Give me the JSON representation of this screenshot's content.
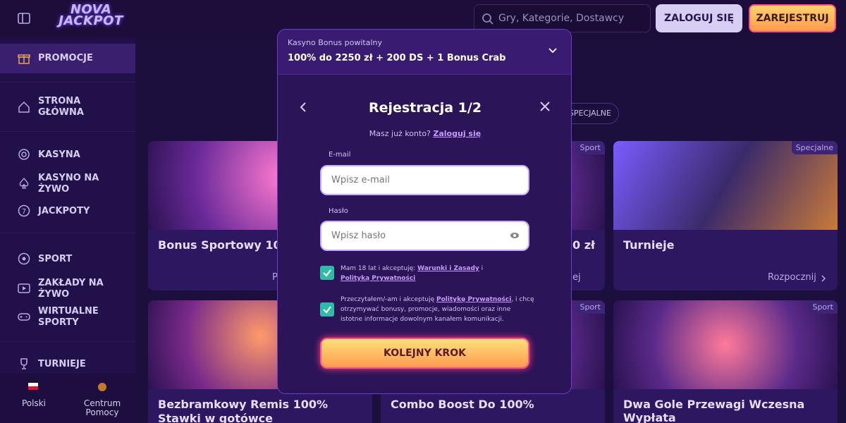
{
  "header": {
    "logo_line1": "NOVA",
    "logo_line2": "JACKPOT",
    "search_placeholder": "Gry, Kategorie, Dostawcy",
    "login_label": "ZALOGUJ SIĘ",
    "register_label": "ZAREJESTRUJ"
  },
  "sidebar": {
    "items": [
      {
        "label": "PROMOCJE",
        "icon": "gift-icon"
      },
      {
        "label": "STRONA GŁÓWNA",
        "icon": "home-icon"
      },
      {
        "label": "KASYNA",
        "icon": "roulette-icon"
      },
      {
        "label": "KASYNO NA ŻYWO",
        "icon": "spade-icon"
      },
      {
        "label": "JACKPOTY",
        "icon": "seven-icon"
      },
      {
        "label": "SPORT",
        "icon": "ball-icon"
      },
      {
        "label": "ZAKŁADY NA ŻYWO",
        "icon": "play-icon"
      },
      {
        "label": "WIRTUALNE SPORTY",
        "icon": "gamepad-icon"
      },
      {
        "label": "TURNIEJE",
        "icon": "trophy-icon"
      }
    ],
    "language": "Polski",
    "help": "Centrum Pomocy"
  },
  "main": {
    "filter_pill": "SPECJALNE",
    "cards": [
      {
        "title": "Bonus Sportowy 100%",
        "tag": "",
        "cta": "P"
      },
      {
        "title": "0 zł",
        "tag": "Sport",
        "cta": "ej"
      },
      {
        "title": "Turnieje",
        "tag": "Specjalne",
        "cta": "Rozpocznij"
      },
      {
        "title": "Bezbramkowy Remis 100% Stawki w gotówce",
        "tag": "",
        "cta": ""
      },
      {
        "title": "Combo Boost Do 100%",
        "tag": "Sport",
        "cta": ""
      },
      {
        "title": "Dwa Gole Przewagi Wczesna Wypłata",
        "tag": "Sport",
        "cta": ""
      }
    ]
  },
  "modal": {
    "bonus_subtitle": "Kasyno Bonus powitalny",
    "bonus_title": "100% do 2250 zł + 200 DS + 1 Bonus Crab",
    "title": "Rejestracja 1/2",
    "have_account": "Masz już konto?",
    "login_link": "Zaloguj się",
    "email_label": "E-mail",
    "email_placeholder": "Wpisz e-mail",
    "password_label": "Hasło",
    "password_placeholder": "Wpisz hasło",
    "consent1_text": "Mam 18 lat i akceptuję:",
    "consent1_link1": "Warunki i Zasady",
    "consent1_and": "i",
    "consent1_link2": "Polityką Prywatności",
    "consent2_text_a": "Przeczytałem/-am i akceptuję",
    "consent2_link": "Politykę Prywatności",
    "consent2_text_b": ", i chcę otrzymywać bonusy, promocje, wiadomości oraz inne istotne informacje dowolnym kanałem komunikacji.",
    "next_label": "KOLEJNY KROK"
  },
  "colors": {
    "accent": "#2fbba5",
    "cta": "#ff9b4e",
    "border": "#6a3fc9"
  }
}
